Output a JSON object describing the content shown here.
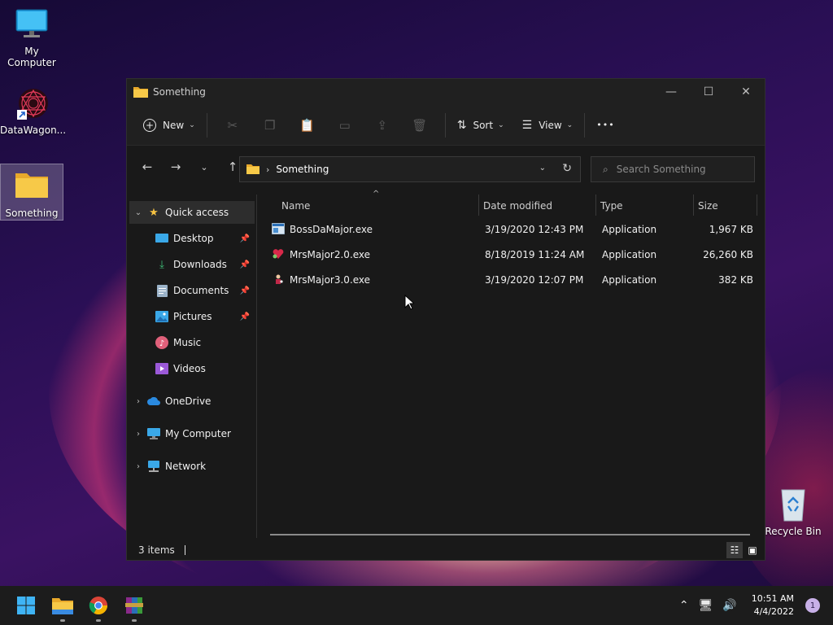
{
  "desktop": {
    "icons": [
      {
        "label": "My Computer"
      },
      {
        "label": "DataWagon..."
      },
      {
        "label": "Something"
      },
      {
        "label": "Recycle Bin"
      }
    ]
  },
  "window": {
    "title": "Something",
    "controls": {
      "minimize": "—",
      "maximize": "☐",
      "close": "✕"
    },
    "toolbar": {
      "new_label": "New",
      "sort_label": "Sort",
      "view_label": "View",
      "more_label": "•••"
    },
    "address": {
      "crumbs": [
        "Something"
      ]
    },
    "search": {
      "placeholder": "Search Something"
    },
    "sidebar": {
      "items": [
        {
          "label": "Quick access"
        },
        {
          "label": "Desktop"
        },
        {
          "label": "Downloads"
        },
        {
          "label": "Documents"
        },
        {
          "label": "Pictures"
        },
        {
          "label": "Music"
        },
        {
          "label": "Videos"
        },
        {
          "label": "OneDrive"
        },
        {
          "label": "My Computer"
        },
        {
          "label": "Network"
        }
      ]
    },
    "columns": [
      "Name",
      "Date modified",
      "Type",
      "Size"
    ],
    "files": [
      {
        "name": "BossDaMajor.exe",
        "date": "3/19/2020 12:43 PM",
        "type": "Application",
        "size": "1,967 KB"
      },
      {
        "name": "MrsMajor2.0.exe",
        "date": "8/18/2019 11:24 AM",
        "type": "Application",
        "size": "26,260 KB"
      },
      {
        "name": "MrsMajor3.0.exe",
        "date": "3/19/2020 12:07 PM",
        "type": "Application",
        "size": "382 KB"
      }
    ],
    "status": {
      "items_count": "3 items"
    }
  },
  "taskbar": {
    "clock": {
      "time": "10:51 AM",
      "date": "4/4/2022"
    },
    "notification_count": "1"
  },
  "colors": {
    "accent": "#0a84ff",
    "folder": "#f5c242",
    "window_bg": "#191919"
  }
}
